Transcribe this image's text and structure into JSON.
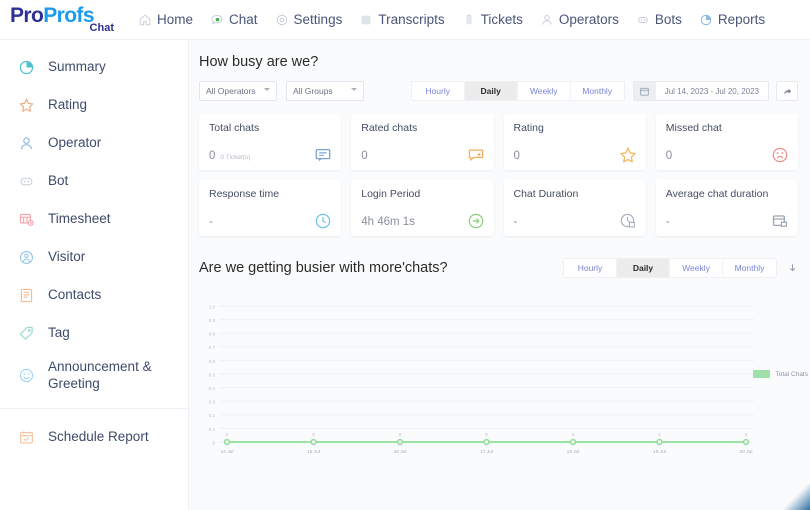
{
  "brand": {
    "name_part1": "Pro",
    "name_part2": "Profs",
    "sub": "Chat"
  },
  "topnav": {
    "items": [
      {
        "label": "Home",
        "icon": "home-icon"
      },
      {
        "label": "Chat",
        "icon": "chat-bubble-icon"
      },
      {
        "label": "Settings",
        "icon": "gear-icon"
      },
      {
        "label": "Transcripts",
        "icon": "transcript-icon"
      },
      {
        "label": "Tickets",
        "icon": "ticket-icon"
      },
      {
        "label": "Operators",
        "icon": "user-icon"
      },
      {
        "label": "Bots",
        "icon": "bot-icon"
      },
      {
        "label": "Reports",
        "icon": "pie-chart-icon"
      }
    ]
  },
  "sidebar": {
    "items": [
      {
        "label": "Summary",
        "icon": "pie-chart-icon",
        "color": "#4fc3c9"
      },
      {
        "label": "Rating",
        "icon": "star-icon",
        "color": "#f1a97a"
      },
      {
        "label": "Operator",
        "icon": "person-icon",
        "color": "#8fb8e0"
      },
      {
        "label": "Bot",
        "icon": "bot-icon",
        "color": "#c9d2dc"
      },
      {
        "label": "Timesheet",
        "icon": "timesheet-icon",
        "color": "#f2a0a6"
      },
      {
        "label": "Visitor",
        "icon": "visitor-icon",
        "color": "#8fc8e8"
      },
      {
        "label": "Contacts",
        "icon": "contacts-icon",
        "color": "#f6bb8e"
      },
      {
        "label": "Tag",
        "icon": "tag-icon",
        "color": "#9fd8d4"
      },
      {
        "label": "Announcement & Greeting",
        "icon": "smiley-icon",
        "color": "#9fd2ee"
      }
    ],
    "footer_items": [
      {
        "label": "Schedule Report",
        "icon": "calendar-check-icon",
        "color": "#f6c2a0"
      }
    ]
  },
  "section1": {
    "title": "How busy are we?",
    "operator_filter": "All Operators",
    "group_filter": "All Groups",
    "range_tabs": [
      "Hourly",
      "Daily",
      "Weekly",
      "Monthly"
    ],
    "range_active": "Daily",
    "date_range": "Jul 14, 2023 - Jul 20, 2023",
    "share_icon": "share-arrow-icon",
    "calendar_icon": "calendar-icon"
  },
  "cards_row1": [
    {
      "title": "Total chats",
      "value": "0",
      "sub": "0 Ticket(s)",
      "icon": "chat-bubble-icon",
      "color": "#7a9fd4"
    },
    {
      "title": "Rated chats",
      "value": "0",
      "sub": "",
      "icon": "rated-chat-icon",
      "color": "#f2ae5e"
    },
    {
      "title": "Rating",
      "value": "0",
      "sub": "",
      "icon": "star-icon",
      "color": "#f4b55e"
    },
    {
      "title": "Missed chat",
      "value": "0",
      "sub": "",
      "icon": "sad-face-icon",
      "color": "#f08d8d"
    }
  ],
  "cards_row2": [
    {
      "title": "Response time",
      "value": "-",
      "sub": "",
      "icon": "clock-icon",
      "color": "#6fc4e8"
    },
    {
      "title": "Login Period",
      "value": "4h 46m 1s",
      "sub": "",
      "icon": "arrow-right-circle-icon",
      "color": "#8cd07a"
    },
    {
      "title": "Chat Duration",
      "value": "-",
      "sub": "",
      "icon": "clock-square-icon",
      "color": "#aab2bd"
    },
    {
      "title": "Average chat duration",
      "value": "-",
      "sub": "",
      "icon": "calendar-icon",
      "color": "#9aa3af"
    }
  ],
  "section2": {
    "title": "Are we getting busier with more'chats?",
    "range_tabs": [
      "Hourly",
      "Daily",
      "Weekly",
      "Monthly"
    ],
    "range_active": "Daily",
    "download_icon": "download-arrow-icon"
  },
  "chart_data": {
    "type": "line",
    "title": "Are we getting busier with more'chats?",
    "xlabel": "",
    "ylabel": "",
    "x": [
      "14 Jul",
      "15 Jul",
      "16 Jul",
      "17 Jul",
      "18 Jul",
      "19 Jul",
      "20 Jul"
    ],
    "yticks": [
      "0",
      "0.1",
      "0.2",
      "0.3",
      "0.4",
      "0.5",
      "0.6",
      "0.7",
      "0.8",
      "0.9",
      "1.0"
    ],
    "ylim": [
      0,
      1.0
    ],
    "grid": true,
    "legend_position": "right",
    "series": [
      {
        "name": "Total Chats",
        "color": "#8ede95",
        "values": [
          0,
          0,
          0,
          0,
          0,
          0,
          0
        ],
        "point_labels": [
          "0",
          "0",
          "0",
          "0",
          "0",
          "0",
          "0"
        ]
      }
    ]
  }
}
